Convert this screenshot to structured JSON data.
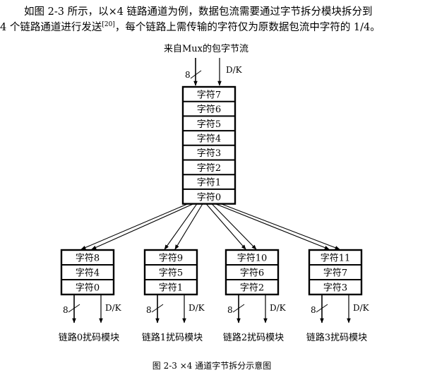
{
  "paragraph": {
    "line1": "如图 2-3 所示，以×4 链路通道为例，数据包流需要通过字节拆分模块拆分到",
    "line2_before_ref": "4 个链路通道进行发送",
    "ref": "[20]",
    "line2_after_ref": "，每个链路上需传输的字符仅为原数据包流中字符的 1/4。"
  },
  "figure": {
    "input_label": "来自Mux的包字节流",
    "width_label": "8",
    "dk_label": "D/K",
    "main_stack": [
      "字符7",
      "字符6",
      "字符5",
      "字符4",
      "字符3",
      "字符2",
      "字符1",
      "字符0"
    ],
    "lanes": [
      {
        "cells": [
          "字符8",
          "字符4",
          "字符0"
        ],
        "label": "链路0扰码模块"
      },
      {
        "cells": [
          "字符9",
          "字符5",
          "字符1"
        ],
        "label": "链路1扰码模块"
      },
      {
        "cells": [
          "字符10",
          "字符6",
          "字符2"
        ],
        "label": "链路2扰码模块"
      },
      {
        "cells": [
          "字符11",
          "字符7",
          "字符3"
        ],
        "label": "链路3扰码模块"
      }
    ],
    "caption": "图 2-3  ×4 通道字节拆分示意图"
  }
}
